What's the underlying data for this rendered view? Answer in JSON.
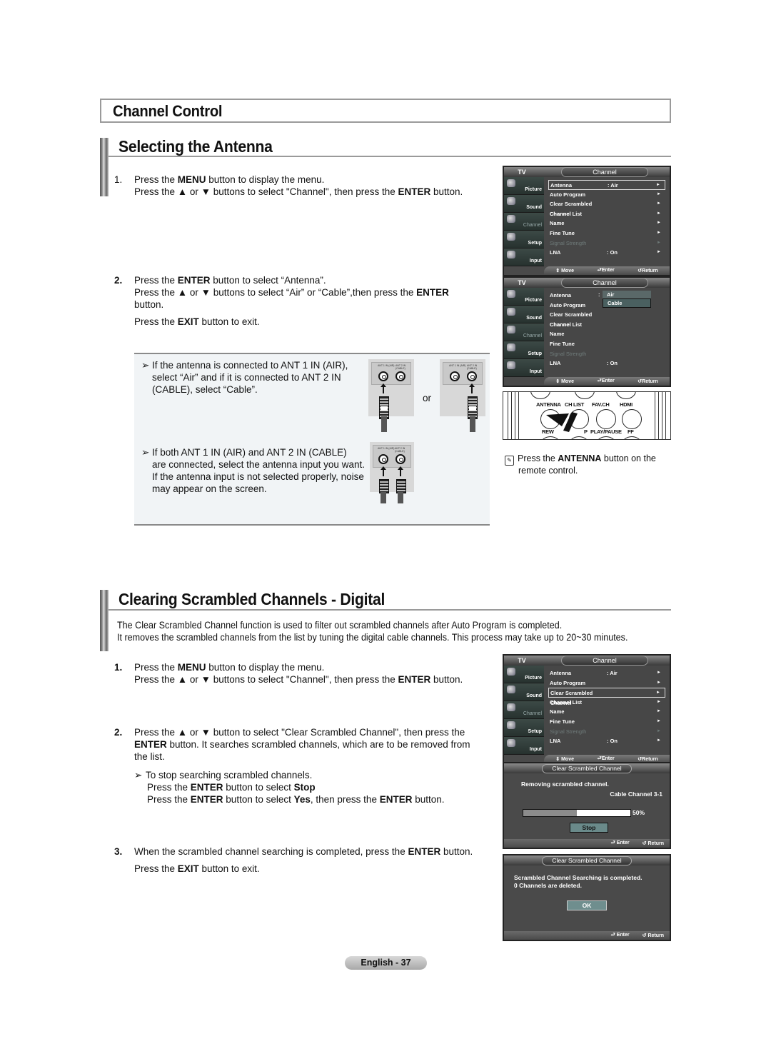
{
  "chapter": {
    "title": "Channel Control"
  },
  "section1": {
    "title": "Selecting the Antenna",
    "steps": [
      {
        "num": "1.",
        "lines": [
          [
            {
              "t": "Press the "
            },
            {
              "t": "MENU",
              "b": true
            },
            {
              "t": " button to display the menu."
            }
          ],
          [
            {
              "t": "Press the ▲ or ▼ buttons to select \"Channel\", then press the "
            },
            {
              "t": "ENTER",
              "b": true
            },
            {
              "t": " button."
            }
          ]
        ]
      },
      {
        "num": "2.",
        "lines": [
          [
            {
              "t": "Press the "
            },
            {
              "t": "ENTER",
              "b": true
            },
            {
              "t": " button to select “Antenna”."
            }
          ],
          [
            {
              "t": "Press the ▲ or ▼ buttons to select “Air” or “Cable”,then press the "
            },
            {
              "t": "ENTER",
              "b": true
            }
          ],
          [
            {
              "t": "button."
            }
          ]
        ]
      },
      {
        "exit": [
          {
            "t": "Press the "
          },
          {
            "t": "EXIT",
            "b": true
          },
          {
            "t": " button to exit."
          }
        ]
      }
    ],
    "notes": [
      {
        "lines": [
          "If the antenna is connected to ANT 1 IN (AIR),",
          "select “Air” and if it is connected to ANT 2 IN",
          "(CABLE), select “Cable”."
        ]
      },
      {
        "lines": [
          "If both ANT 1 IN (AIR) and ANT 2 IN (CABLE)",
          "are connected, select the antenna input you want.",
          "If the antenna input is not selected properly, noise",
          "may appear on the screen."
        ]
      }
    ],
    "or_label": "or",
    "jack_labels": {
      "ant1": "ANT 1 IN (AIR)",
      "ant2": "ANT 2 IN (CABLE)"
    },
    "remote": {
      "top_buttons": [
        "ANTENNA",
        "CH LIST",
        "FAV.CH",
        "HDMI"
      ],
      "bottom_buttons": [
        "REW",
        "STOP",
        "PLAY/PAUSE",
        "FF"
      ]
    },
    "remote_note": [
      {
        "t": "Press the "
      },
      {
        "t": "ANTENNA",
        "b": true
      },
      {
        "t": " button on the"
      }
    ],
    "remote_note_2": "remote control."
  },
  "osd_menu": {
    "tv_label": "TV",
    "title": "Channel",
    "sidebar": [
      "Picture",
      "Sound",
      "Channel",
      "Setup",
      "Input"
    ],
    "items": [
      {
        "name": "Antenna",
        "value": ": Air"
      },
      {
        "name": "Auto Program",
        "value": ""
      },
      {
        "name": "Clear Scrambled Channel",
        "value": ""
      },
      {
        "name": "Channel List",
        "value": ""
      },
      {
        "name": "Name",
        "value": ""
      },
      {
        "name": "Fine Tune",
        "value": ""
      },
      {
        "name": "Signal Strength",
        "value": "",
        "disabled": true
      },
      {
        "name": "LNA",
        "value": ": On"
      }
    ],
    "arrow": "►",
    "footer": {
      "move": "Move",
      "enter": "Enter",
      "return": "Return"
    },
    "dropdown": {
      "options": [
        "Air",
        "Cable"
      ],
      "highlighted": "Cable",
      "separator": ":"
    }
  },
  "section2": {
    "title": "Clearing Scrambled Channels - Digital",
    "intro": [
      "The Clear Scrambled Channel function is used to filter out scrambled channels after Auto Program is completed.",
      "It removes the scrambled channels from the list by tuning the digital cable channels. This process may take up to 20~30 minutes."
    ],
    "steps": [
      {
        "num": "1.",
        "lines": [
          [
            {
              "t": "Press the "
            },
            {
              "t": "MENU",
              "b": true
            },
            {
              "t": " button to display the menu."
            }
          ],
          [
            {
              "t": "Press the ▲ or ▼ buttons to select \"Channel\", then press the "
            },
            {
              "t": "ENTER",
              "b": true
            },
            {
              "t": " button."
            }
          ]
        ]
      },
      {
        "num": "2.",
        "lines": [
          [
            {
              "t": "Press the ▲ or ▼ button to select \"Clear Scrambled Channel\", then press the"
            }
          ],
          [
            {
              "t": "ENTER",
              "b": true
            },
            {
              "t": " button. It searches scrambled channels, which are to be removed from"
            }
          ],
          [
            {
              "t": "the list."
            }
          ]
        ]
      },
      {
        "num": "3.",
        "lines": [
          [
            {
              "t": "When the scrambled channel searching is completed, press the "
            },
            {
              "t": "ENTER",
              "b": true
            },
            {
              "t": " button."
            }
          ]
        ]
      }
    ],
    "stop_note": [
      [
        {
          "t": "To stop searching scrambled channels."
        }
      ],
      [
        {
          "t": "Press the "
        },
        {
          "t": "ENTER",
          "b": true
        },
        {
          "t": " button to select "
        },
        {
          "t": "Stop",
          "b": true
        }
      ],
      [
        {
          "t": "Press the "
        },
        {
          "t": "ENTER",
          "b": true
        },
        {
          "t": " button to select "
        },
        {
          "t": "Yes",
          "b": true
        },
        {
          "t": ", then press the "
        },
        {
          "t": "ENTER",
          "b": true
        },
        {
          "t": " button."
        }
      ]
    ],
    "exit": [
      {
        "t": "Press the "
      },
      {
        "t": "EXIT",
        "b": true
      },
      {
        "t": " button to exit."
      }
    ]
  },
  "dialog_progress": {
    "title": "Clear Scrambled Channel",
    "message": "Removing scrambled channel.",
    "channel": "Cable Channel 3-1",
    "progress_percent": 50,
    "progress_label": "50%",
    "stop_button": "Stop",
    "footer": {
      "enter": "Enter",
      "return": "Return"
    }
  },
  "dialog_done": {
    "title": "Clear Scrambled Channel",
    "message_1": "Scrambled Channel Searching is completed.",
    "message_2": "0 Channels are deleted.",
    "ok_button": "OK",
    "footer": {
      "enter": "Enter",
      "return": "Return"
    }
  },
  "footer": {
    "page_label": "English - 37"
  }
}
